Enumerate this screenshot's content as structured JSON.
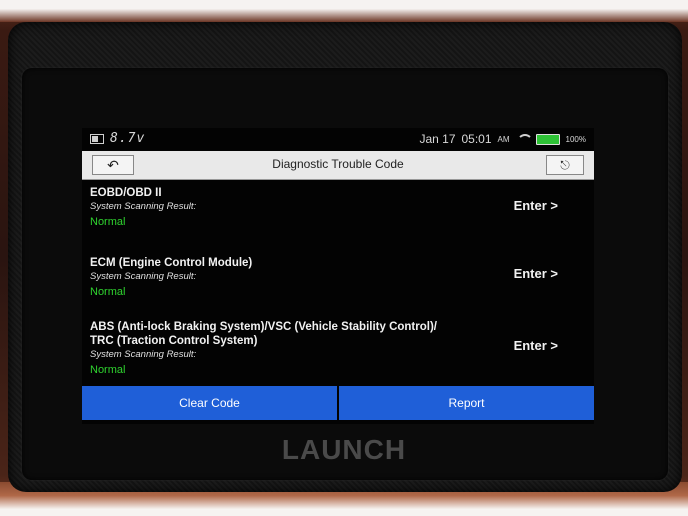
{
  "status_bar": {
    "voltage": "8.7v",
    "date": "Jan 17",
    "time": "05:01",
    "ampm": "AM",
    "battery_percent": "100%"
  },
  "header": {
    "title": "Diagnostic Trouble Code"
  },
  "systems": [
    {
      "name_line1": "EOBD/OBD II",
      "name_line2": "",
      "result_label": "System Scanning Result:",
      "result": "Normal",
      "action": "Enter >"
    },
    {
      "name_line1": "ECM (Engine Control Module)",
      "name_line2": "",
      "result_label": "System Scanning Result:",
      "result": "Normal",
      "action": "Enter >"
    },
    {
      "name_line1": "ABS (Anti-lock Braking System)/VSC (Vehicle Stability Control)/",
      "name_line2": "TRC (Traction Control System)",
      "result_label": "System Scanning Result:",
      "result": "Normal",
      "action": "Enter >"
    }
  ],
  "buttons": {
    "clear_code": "Clear Code",
    "report": "Report"
  },
  "brand": "LAUNCH",
  "colors": {
    "status_normal": "#2fd32f",
    "button_blue": "#1f5fd8",
    "battery_green": "#2ec236"
  }
}
